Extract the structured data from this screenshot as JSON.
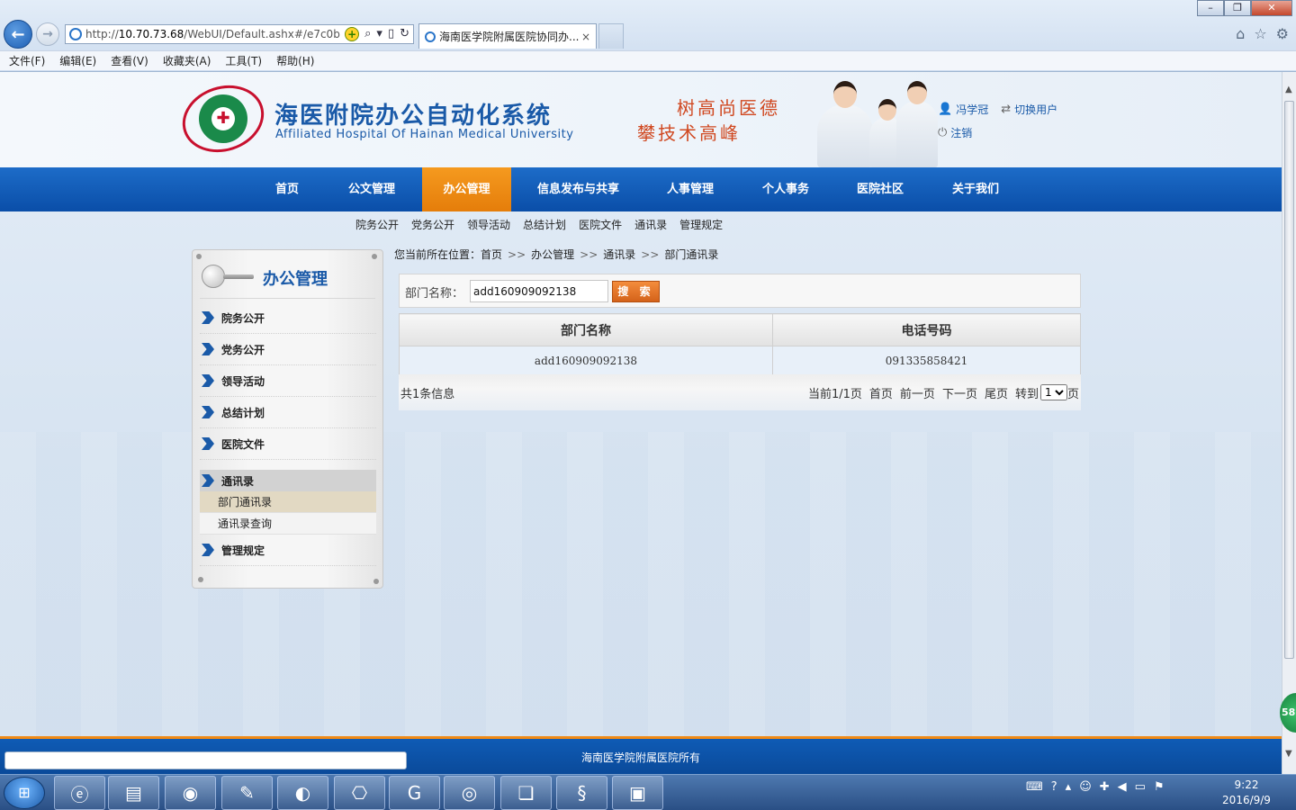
{
  "browser": {
    "url_prefix": "http://",
    "url_host": "10.70.73.68",
    "url_path": "/WebUI/Default.ashx#/e7c0b",
    "tab_title": "海南医学院附属医院协同办...",
    "tab_close": "×",
    "menu": [
      "文件(F)",
      "编辑(E)",
      "查看(V)",
      "收藏夹(A)",
      "工具(T)",
      "帮助(H)"
    ]
  },
  "header": {
    "title": "海医附院办公自动化系统",
    "subtitle": "Affiliated Hospital Of Hainan Medical University",
    "motto_line1": "树高尚医德",
    "motto_line2": "攀技术高峰",
    "user_name": "冯学冠",
    "switch_user": "切换用户",
    "logout": "注销"
  },
  "nav": {
    "items": [
      "首页",
      "公文管理",
      "办公管理",
      "信息发布与共享",
      "人事管理",
      "个人事务",
      "医院社区",
      "关于我们"
    ],
    "active_index": 2
  },
  "subnav": [
    "院务公开",
    "党务公开",
    "领导活动",
    "总结计划",
    "医院文件",
    "通讯录",
    "管理规定"
  ],
  "sidebar": {
    "title": "办公管理",
    "items": [
      "院务公开",
      "党务公开",
      "领导活动",
      "总结计划",
      "医院文件",
      "通讯录",
      "管理规定"
    ],
    "open_item": "通讯录",
    "sub_items": [
      "部门通讯录",
      "通讯录查询"
    ],
    "active_sub": "部门通讯录"
  },
  "breadcrumb": {
    "prefix": "您当前所在位置：",
    "path": [
      "首页",
      "办公管理",
      "通讯录",
      "部门通讯录"
    ],
    "separator": ">>"
  },
  "search": {
    "label": "部门名称：",
    "value": "add160909092138",
    "button": "搜 索"
  },
  "table": {
    "columns": [
      "部门名称",
      "电话号码"
    ],
    "rows": [
      [
        "add160909092138",
        "091335858421"
      ]
    ]
  },
  "pager": {
    "total": "共1条信息",
    "current": "当前1/1页",
    "first": "首页",
    "prev": "前一页",
    "next": "下一页",
    "last": "尾页",
    "goto": "转到",
    "page_value": "1",
    "page_suffix": "页"
  },
  "footer": {
    "copyright": "海南医学院附属医院所有"
  },
  "float_badge": "58",
  "taskbar": {
    "apps": [
      "ie-icon",
      "explorer-icon",
      "chrome-icon",
      "notepad-icon",
      "firefox-icon",
      "pdf-icon",
      "foxit-icon",
      "app-icon",
      "python-doc-icon",
      "python-icon",
      "window-icon"
    ],
    "time": "9:22",
    "date": "2016/9/9"
  },
  "colors": {
    "nav_blue": "#0a4ea8",
    "nav_active": "#e57d0a",
    "title_blue": "#1a5aa8",
    "motto_red": "#d04820",
    "footer_border": "#f08a16"
  }
}
